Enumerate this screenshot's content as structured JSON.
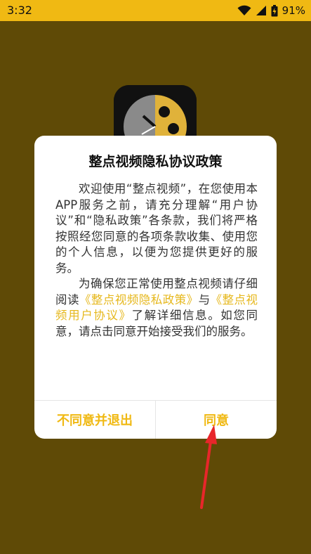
{
  "status_bar": {
    "time": "3:32",
    "battery": "91%"
  },
  "dialog": {
    "title": "整点视频隐私协议政策",
    "para1": "欢迎使用“整点视频”，在您使用本APP服务之前，请充分理解“用户协议”和“隐私政策”各条款，我们将严格按照经您同意的各项条款收集、使用您的个人信息，以便为您提供更好的服务。",
    "para2_prefix": "为确保您正常使用整点视频请仔细阅读",
    "privacy_link": "《整点视频隐私政策》",
    "para2_mid": "与",
    "agreement_link": "《整点视频用户协议》",
    "para2_suffix": "了解详细信息。如您同意，请点击同意开始接受我们的服务。",
    "disagree_label": "不同意并退出",
    "agree_label": "同意"
  },
  "colors": {
    "accent": "#f0b913",
    "link": "#e6b81d",
    "overlay": "#5f4a06",
    "annotation_arrow": "#e8262a"
  }
}
